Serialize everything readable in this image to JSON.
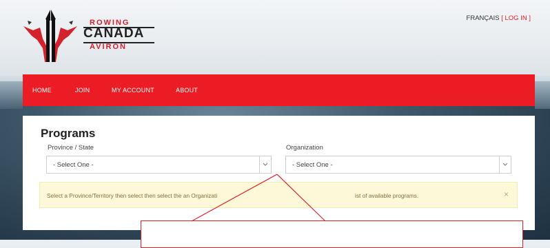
{
  "header": {
    "logo": {
      "line1": "ROWING",
      "line2": "CANADA",
      "line3": "AVIRON",
      "icon": "maple-leaf-rower-icon",
      "colors": {
        "red": "#d4222c",
        "black": "#222222"
      }
    },
    "language_link": "FRANÇAIS",
    "login_link": "[ LOG IN ]"
  },
  "nav": {
    "background": "#ec1c24",
    "items": [
      {
        "label": "HOME"
      },
      {
        "label": "JOIN"
      },
      {
        "label": "MY ACCOUNT"
      },
      {
        "label": "ABOUT"
      }
    ]
  },
  "main": {
    "title": "Programs",
    "province": {
      "label": "Province / State",
      "selected": "- Select One -"
    },
    "organization": {
      "label": "Organization",
      "selected": "- Select One -"
    },
    "alert": {
      "text_start": "Select a Province/Territory then select then select the an Organizati",
      "text_end": "ist of available programs.",
      "close": "×"
    }
  },
  "annotation": {
    "color": "#e0202a"
  }
}
